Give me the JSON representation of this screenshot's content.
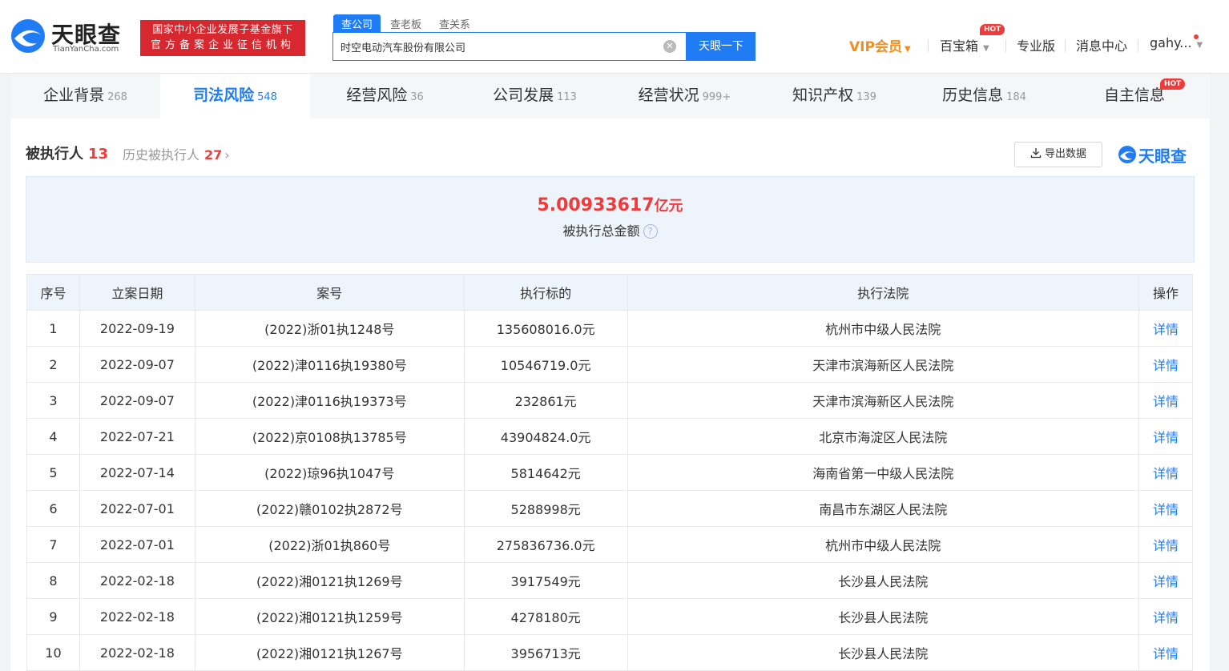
{
  "header": {
    "logo_cn": "天眼查",
    "logo_en": "TianYanCha.com",
    "badge_line1": "国家中小企业发展子基金旗下",
    "badge_line2": "官方备案企业征信机构",
    "search_tabs": [
      "查公司",
      "查老板",
      "查关系"
    ],
    "search_value": "时空电动汽车股份有限公司",
    "search_button": "天眼一下",
    "nav": {
      "vip": "VIP会员",
      "treasure": "百宝箱",
      "hot": "HOT",
      "pro": "专业版",
      "messages": "消息中心",
      "user": "gahy..."
    }
  },
  "main_tabs": [
    {
      "label": "企业背景",
      "count": "268"
    },
    {
      "label": "司法风险",
      "count": "548"
    },
    {
      "label": "经营风险",
      "count": "36"
    },
    {
      "label": "公司发展",
      "count": "113"
    },
    {
      "label": "经营状况",
      "count": "999+"
    },
    {
      "label": "知识产权",
      "count": "139"
    },
    {
      "label": "历史信息",
      "count": "184"
    },
    {
      "label": "自主信息",
      "count": "",
      "hot": "HOT"
    }
  ],
  "section": {
    "title": "被执行人",
    "count": "13",
    "history_label": "历史被执行人",
    "history_count": "27",
    "export_label": "导出数据",
    "watermark": "天眼查"
  },
  "summary": {
    "amount": "5.00933617",
    "unit": "亿元",
    "label": "被执行总金额"
  },
  "table": {
    "headers": [
      "序号",
      "立案日期",
      "案号",
      "执行标的",
      "执行法院",
      "操作"
    ],
    "rows": [
      [
        "1",
        "2022-09-19",
        "(2022)浙01执1248号",
        "135608016.0元",
        "杭州市中级人民法院",
        "详情"
      ],
      [
        "2",
        "2022-09-07",
        "(2022)津0116执19380号",
        "10546719.0元",
        "天津市滨海新区人民法院",
        "详情"
      ],
      [
        "3",
        "2022-09-07",
        "(2022)津0116执19373号",
        "232861元",
        "天津市滨海新区人民法院",
        "详情"
      ],
      [
        "4",
        "2022-07-21",
        "(2022)京0108执13785号",
        "43904824.0元",
        "北京市海淀区人民法院",
        "详情"
      ],
      [
        "5",
        "2022-07-14",
        "(2022)琼96执1047号",
        "5814642元",
        "海南省第一中级人民法院",
        "详情"
      ],
      [
        "6",
        "2022-07-01",
        "(2022)赣0102执2872号",
        "5288998元",
        "南昌市东湖区人民法院",
        "详情"
      ],
      [
        "7",
        "2022-07-01",
        "(2022)浙01执860号",
        "275836736.0元",
        "杭州市中级人民法院",
        "详情"
      ],
      [
        "8",
        "2022-02-18",
        "(2022)湘0121执1269号",
        "3917549元",
        "长沙县人民法院",
        "详情"
      ],
      [
        "9",
        "2022-02-18",
        "(2022)湘0121执1259号",
        "4278180元",
        "长沙县人民法院",
        "详情"
      ],
      [
        "10",
        "2022-02-18",
        "(2022)湘0121执1267号",
        "3956713元",
        "长沙县人民法院",
        "详情"
      ]
    ]
  },
  "colors": {
    "accent": "#1f7cf5",
    "alert": "#f03b3b",
    "vip": "#f08f1f",
    "badge": "#d8282f"
  }
}
